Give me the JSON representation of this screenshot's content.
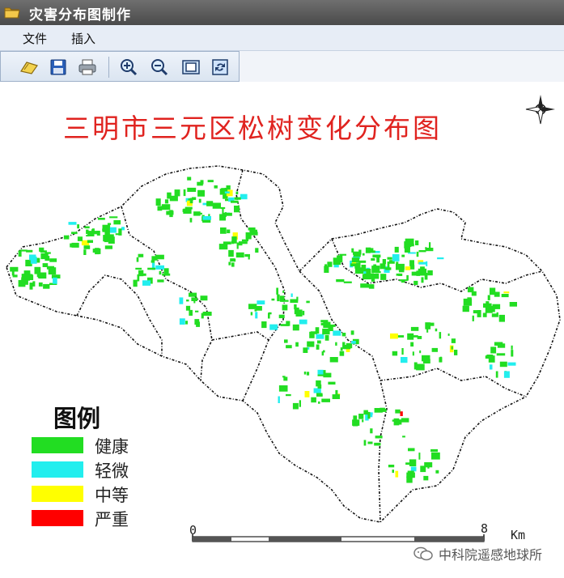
{
  "window": {
    "title": "灾害分布图制作"
  },
  "menu": {
    "items": [
      {
        "label": "文件"
      },
      {
        "label": "插入"
      }
    ]
  },
  "toolbar": {
    "buttons": [
      {
        "name": "open-folder",
        "icon": "folder-open-icon"
      },
      {
        "name": "save",
        "icon": "floppy-disk-icon"
      },
      {
        "name": "print",
        "icon": "printer-icon"
      },
      {
        "name": "zoom-in",
        "icon": "zoom-in-icon"
      },
      {
        "name": "zoom-out",
        "icon": "zoom-out-icon"
      },
      {
        "name": "full-extent",
        "icon": "full-extent-icon"
      },
      {
        "name": "refresh",
        "icon": "refresh-icon"
      }
    ]
  },
  "map": {
    "title": "三明市三元区松树变化分布图",
    "legend": {
      "title": "图例",
      "items": [
        {
          "label": "健康",
          "color": "#22dd22"
        },
        {
          "label": "轻微",
          "color": "#22eeee"
        },
        {
          "label": "中等",
          "color": "#ffff00"
        },
        {
          "label": "严重",
          "color": "#ff0000"
        }
      ]
    },
    "scalebar": {
      "start": "0",
      "end": "8",
      "unit": "Km"
    },
    "north_arrow": {
      "icon": "compass-rose-icon"
    }
  },
  "watermark": {
    "text": "中科院遥感地球所",
    "icon": "wechat-icon"
  }
}
